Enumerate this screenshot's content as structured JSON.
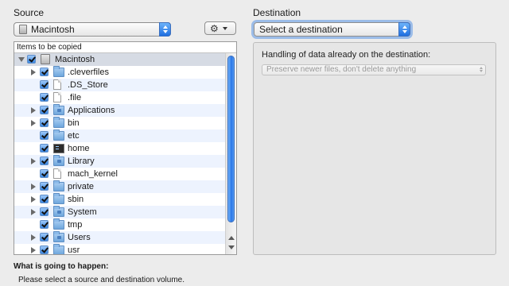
{
  "source": {
    "label": "Source",
    "popup_value": "Macintosh",
    "gear_icon": "gear-icon",
    "tree_header": "Items to be copied",
    "items": [
      {
        "name": "Macintosh",
        "icon": "drive",
        "disclosure": "down",
        "indent": 0
      },
      {
        "name": ".cleverfiles",
        "icon": "folder",
        "disclosure": "right",
        "indent": 1
      },
      {
        "name": ".DS_Store",
        "icon": "file",
        "disclosure": "none",
        "indent": 1
      },
      {
        "name": ".file",
        "icon": "file",
        "disclosure": "none",
        "indent": 1
      },
      {
        "name": "Applications",
        "icon": "folder-badge",
        "disclosure": "right",
        "indent": 1
      },
      {
        "name": "bin",
        "icon": "folder",
        "disclosure": "right",
        "indent": 1
      },
      {
        "name": "etc",
        "icon": "folder",
        "disclosure": "none",
        "indent": 1
      },
      {
        "name": "home",
        "icon": "exec",
        "disclosure": "none",
        "indent": 1
      },
      {
        "name": "Library",
        "icon": "folder-badge",
        "disclosure": "right",
        "indent": 1
      },
      {
        "name": "mach_kernel",
        "icon": "file",
        "disclosure": "none",
        "indent": 1
      },
      {
        "name": "private",
        "icon": "folder",
        "disclosure": "right",
        "indent": 1
      },
      {
        "name": "sbin",
        "icon": "folder",
        "disclosure": "right",
        "indent": 1
      },
      {
        "name": "System",
        "icon": "folder-badge",
        "disclosure": "right",
        "indent": 1
      },
      {
        "name": "tmp",
        "icon": "folder",
        "disclosure": "none",
        "indent": 1
      },
      {
        "name": "Users",
        "icon": "folder-badge",
        "disclosure": "right",
        "indent": 1
      },
      {
        "name": "usr",
        "icon": "folder",
        "disclosure": "right",
        "indent": 1
      }
    ]
  },
  "destination": {
    "label": "Destination",
    "popup_value": "Select a destination",
    "handling_heading": "Handling of data already on the destination:",
    "handling_value": "Preserve newer files, don't delete anything"
  },
  "summary": {
    "title": "What is going to happen:",
    "text": "Please select a source and destination volume."
  },
  "colors": {
    "accent": "#2a76e6",
    "row_alt": "#edf3fe",
    "window_bg": "#ececec"
  }
}
